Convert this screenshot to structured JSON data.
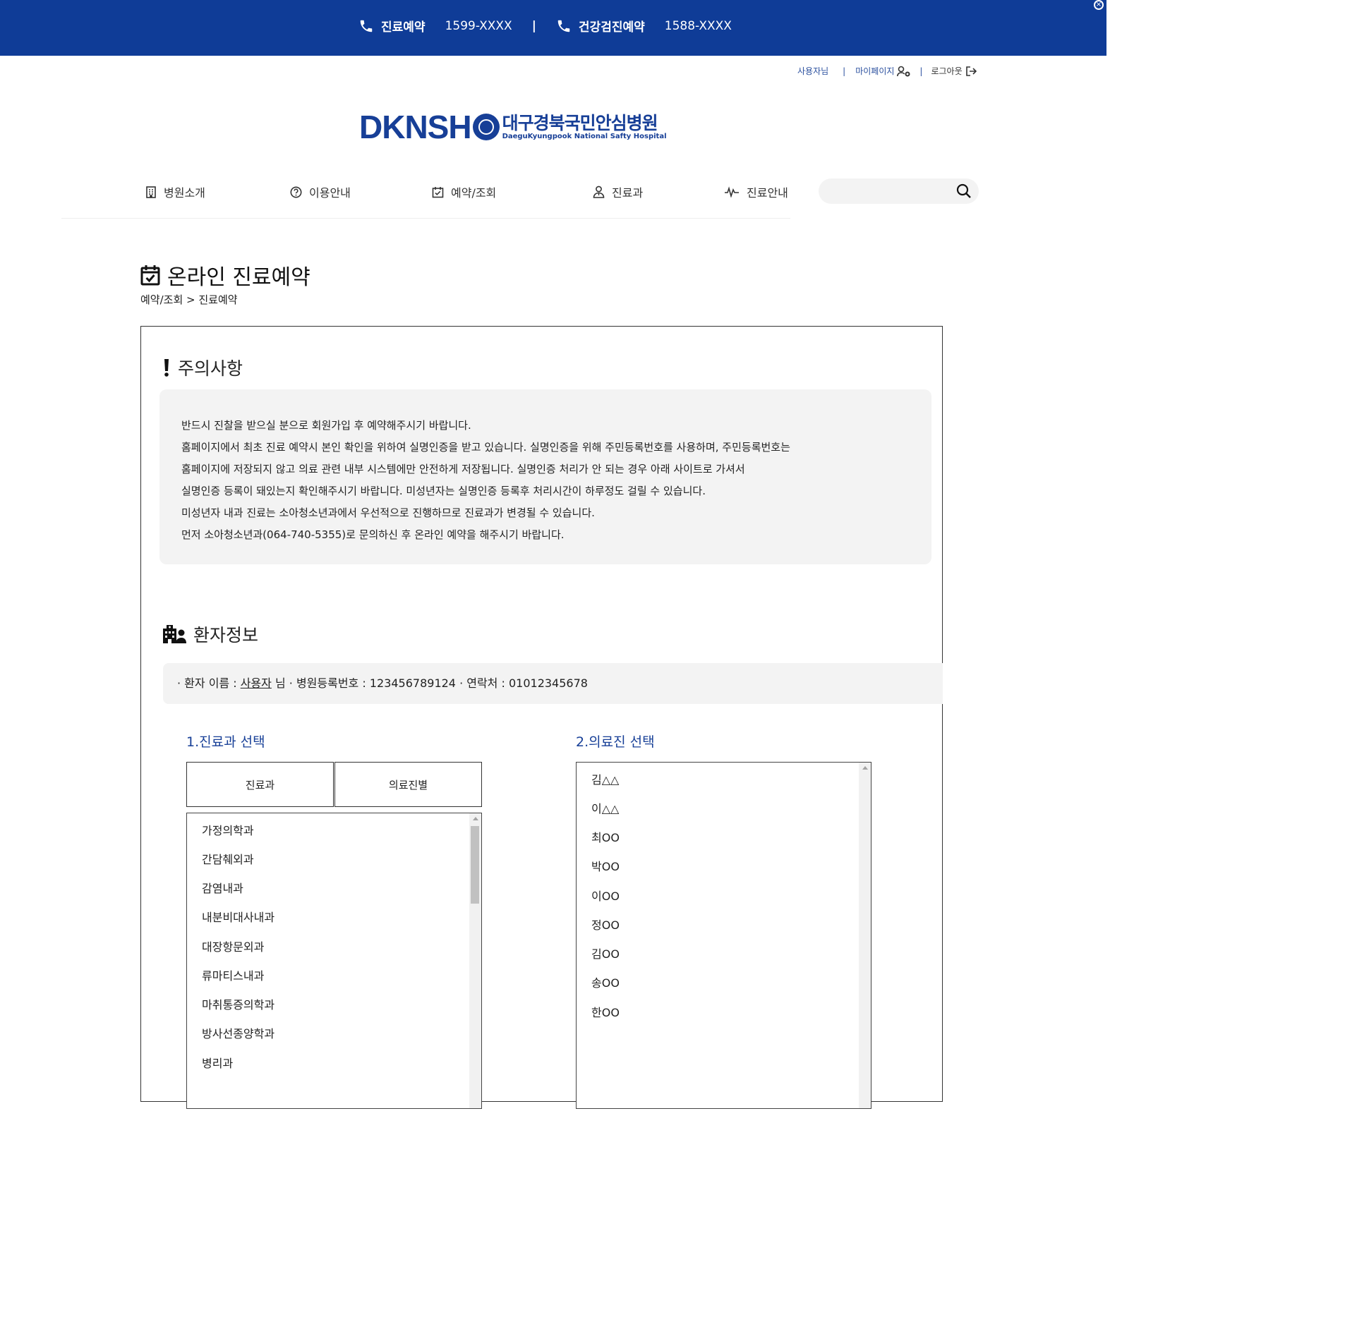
{
  "topbar": {
    "reserve_label": "진료예약",
    "reserve_number": "1599-XXXX",
    "separator": "|",
    "checkup_label": "건강검진예약",
    "checkup_number": "1588-XXXX",
    "colors": {
      "background": "#0f3c97",
      "text": "#ffffff"
    }
  },
  "util_nav": {
    "user": "사용자님",
    "separator": "|",
    "mypage": "마이페이지",
    "logout": "로그아웃"
  },
  "logo": {
    "mark": "DKNSH",
    "name_ko": "대구경북국민안심병원",
    "name_en": "DaeguKyungpook National Safty Hospital",
    "color": "#173f97"
  },
  "gnb": {
    "items": [
      {
        "label": "병원소개",
        "icon": "building-icon"
      },
      {
        "label": "이용안내",
        "icon": "question-circle-icon"
      },
      {
        "label": "예약/조회",
        "icon": "calendar-check-icon"
      },
      {
        "label": "진료과",
        "icon": "doctor-icon"
      },
      {
        "label": "진료안내",
        "icon": "heartbeat-icon"
      }
    ],
    "search_placeholder": ""
  },
  "page": {
    "title": "온라인 진료예약",
    "breadcrumb": "예약/조회 > 진료예약"
  },
  "notice": {
    "title": "주의사항",
    "lines": [
      "반드시 진찰을 받으실 분으로 회원가입 후 예약해주시기 바랍니다.",
      "홈페이지에서 최초 진료 예약시 본인 확인을 위하여 실명인증을 받고 있습니다. 실명인증을 위해 주민등록번호를 사용하며, 주민등록번호는",
      "홈페이지에 저장되지 않고 의료 관련 내부 시스템에만 안전하게 저장됩니다. 실명인증 처리가 안 되는 경우 아래 사이트로 가셔서",
      "실명인증 등록이 돼있는지 확인해주시기 바랍니다. 미성년자는 실명인증 등록후 처리시간이 하루정도 걸릴 수 있습니다.",
      "미성년자 내과 진료는 소아청소년과에서 우선적으로 진행하므로 진료과가 변경될 수 있습니다.",
      "먼저 소아청소년과(064-740-5355)로 문의하신 후 온라인 예약을 해주시기 바랍니다."
    ]
  },
  "patient": {
    "title": "환자정보",
    "name_label": "· 환자 이름 : ",
    "name_value": "사용자",
    "name_suffix": " 님 · 병원등록번호 : ",
    "reg_number": "123456789124",
    "contact_label": " · 연락처 : ",
    "contact_value": "01012345678"
  },
  "step1": {
    "title": "1.진료과 선택",
    "tabs": [
      "진료과",
      "의료진별"
    ],
    "departments": [
      "가정의학과",
      "간담췌외과",
      "감염내과",
      "내분비대사내과",
      "대장항문외과",
      "류마티스내과",
      "마취통증의학과",
      "방사선종양학과",
      "병리과"
    ]
  },
  "step2": {
    "title": "2.의료진 선택",
    "doctors": [
      "김△△",
      "이△△",
      "최OO",
      "박OO",
      "이OO",
      "정OO",
      "김OO",
      "송OO",
      "한OO"
    ]
  }
}
